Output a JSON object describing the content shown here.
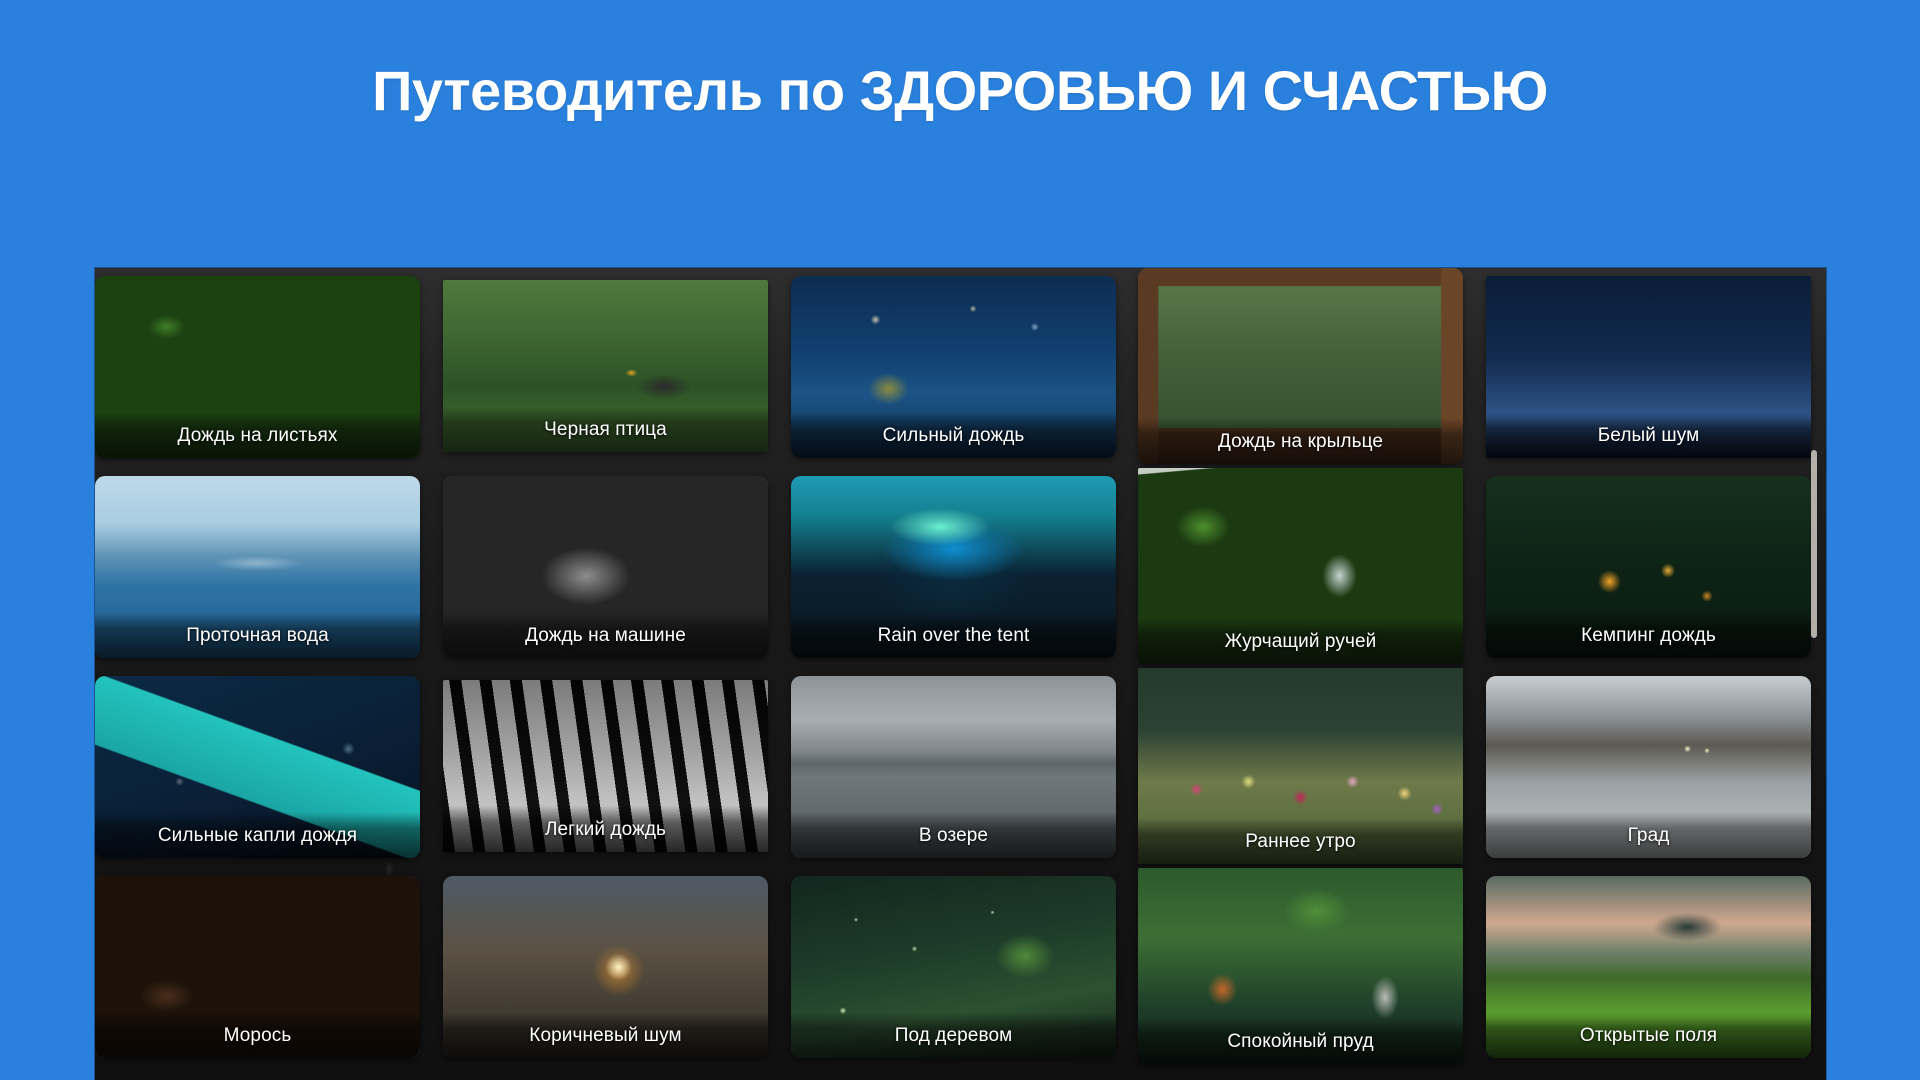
{
  "page": {
    "title": "Путеводитель по ЗДОРОВЬЮ И СЧАСТЬЮ",
    "background_color": "#2980dd",
    "panel_color": "#1a1a1a",
    "accent_color": "#ffffff"
  },
  "gallery": {
    "rows": [
      {
        "cards": [
          {
            "label": "Дождь на листьях",
            "art": "t-leaves",
            "shape": "rounded"
          },
          {
            "label": "Черная птица",
            "art": "t-bird",
            "shape": "flat"
          },
          {
            "label": "Сильный дождь",
            "art": "t-heavy",
            "shape": "rounded"
          },
          {
            "label": "Дождь на крыльце",
            "art": "t-porch",
            "shape": "rounded"
          },
          {
            "label": "Белый шум",
            "art": "t-white",
            "shape": "flat"
          }
        ]
      },
      {
        "cards": [
          {
            "label": "Проточная вода",
            "art": "t-water",
            "shape": "rounded"
          },
          {
            "label": "Дождь на машине",
            "art": "t-carmirror",
            "shape": "rounded"
          },
          {
            "label": "Rain over the tent",
            "art": "t-tent",
            "shape": "rounded"
          },
          {
            "label": "Журчащий ручей",
            "art": "t-stream",
            "shape": "flat"
          },
          {
            "label": "Кемпинг дождь",
            "art": "t-camp",
            "shape": "rounded"
          }
        ]
      },
      {
        "cards": [
          {
            "label": "Сильные капли дождя",
            "art": "t-umbrella",
            "shape": "rounded"
          },
          {
            "label": "Легкий дождь",
            "art": "t-light",
            "shape": "flat"
          },
          {
            "label": "В озере",
            "art": "t-lake",
            "shape": "rounded"
          },
          {
            "label": "Раннее утро",
            "art": "t-flowers",
            "shape": "flat"
          },
          {
            "label": "Град",
            "art": "t-hail",
            "shape": "rounded"
          }
        ]
      },
      {
        "cards": [
          {
            "label": "Морось",
            "art": "t-drizzle",
            "shape": "rounded"
          },
          {
            "label": "Коричневый шум",
            "art": "t-brown",
            "shape": "rounded"
          },
          {
            "label": "Под деревом",
            "art": "t-tree",
            "shape": "rounded"
          },
          {
            "label": "Спокойный пруд",
            "art": "t-pond",
            "shape": "flat"
          },
          {
            "label": "Открытые поля",
            "art": "t-fields",
            "shape": "rounded"
          }
        ]
      }
    ]
  },
  "scrollbar": {
    "thumb_color": "#cfc9c1",
    "orientation": "vertical"
  }
}
